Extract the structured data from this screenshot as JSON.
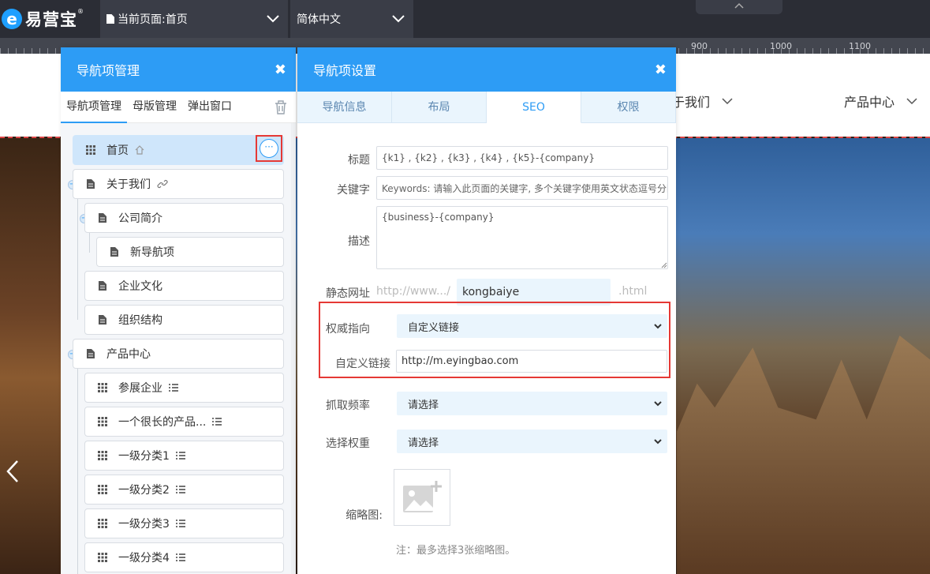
{
  "app": {
    "logo_text": "易营宝",
    "logo_mark": "e",
    "logo_reg": "®",
    "current_page_label": "当前页面:首页",
    "language_label": "简体中文"
  },
  "ruler": {
    "labels": [
      "900",
      "1000",
      "1100"
    ]
  },
  "site": {
    "nav_items": [
      {
        "label": "于我们"
      },
      {
        "label": "产品中心"
      }
    ]
  },
  "nav_manager": {
    "title": "导航项管理",
    "close": "✖",
    "tabs": [
      {
        "label": "导航项管理",
        "active": true
      },
      {
        "label": "母版管理",
        "active": false
      },
      {
        "label": "弹出窗口",
        "active": false
      }
    ],
    "more_button": "···",
    "tree": [
      {
        "label": "首页",
        "icon": "grid-icon",
        "suffix": "home-icon",
        "active": true
      },
      {
        "label": "关于我们",
        "icon": "page-icon",
        "suffix": "link-icon"
      },
      {
        "label": "公司简介",
        "icon": "page-icon"
      },
      {
        "label": "新导航项",
        "icon": "page-icon"
      },
      {
        "label": "企业文化",
        "icon": "page-icon"
      },
      {
        "label": "组织结构",
        "icon": "page-icon"
      },
      {
        "label": "产品中心",
        "icon": "page-icon"
      },
      {
        "label": "参展企业",
        "icon": "grid-icon",
        "suffix": "list-icon"
      },
      {
        "label": "一个很长的产品...",
        "icon": "grid-icon",
        "suffix": "list-icon"
      },
      {
        "label": "一级分类1",
        "icon": "grid-icon",
        "suffix": "list-icon"
      },
      {
        "label": "一级分类2",
        "icon": "grid-icon",
        "suffix": "list-icon"
      },
      {
        "label": "一级分类3",
        "icon": "grid-icon",
        "suffix": "list-icon"
      },
      {
        "label": "一级分类4",
        "icon": "grid-icon",
        "suffix": "list-icon"
      }
    ]
  },
  "nav_settings": {
    "title": "导航项设置",
    "close": "✖",
    "tabs": [
      {
        "label": "导航信息",
        "active": false
      },
      {
        "label": "布局",
        "active": false
      },
      {
        "label": "SEO",
        "active": true
      },
      {
        "label": "权限",
        "active": false
      }
    ],
    "fields": {
      "title_label": "标题",
      "title_value": "{k1} , {k2} , {k3} , {k4} , {k5}-{company}",
      "keywords_label": "关键字",
      "keywords_placeholder": "Keywords: 请输入此页面的关键字, 多个关键字使用英文状态逗号分隔",
      "desc_label": "描述",
      "desc_value": "{business}-{company}",
      "static_url_label": "静态网址",
      "static_url_prefix": "http://www.../",
      "static_url_value": "kongbaiye",
      "static_url_suffix": ".html",
      "authority_label": "权威指向",
      "authority_value": "自定义链接",
      "custom_link_label": "自定义链接",
      "custom_link_value": "http://m.eyingbao.com",
      "crawl_label": "抓取频率",
      "crawl_value": "请选择",
      "weight_label": "选择权重",
      "weight_value": "请选择",
      "thumb_label": "缩略图:",
      "thumb_note": "注：最多选择3张缩略图。"
    }
  },
  "colors": {
    "accent": "#2d9cf5",
    "topbar": "#2b2d35",
    "highlight": "#e53935"
  }
}
